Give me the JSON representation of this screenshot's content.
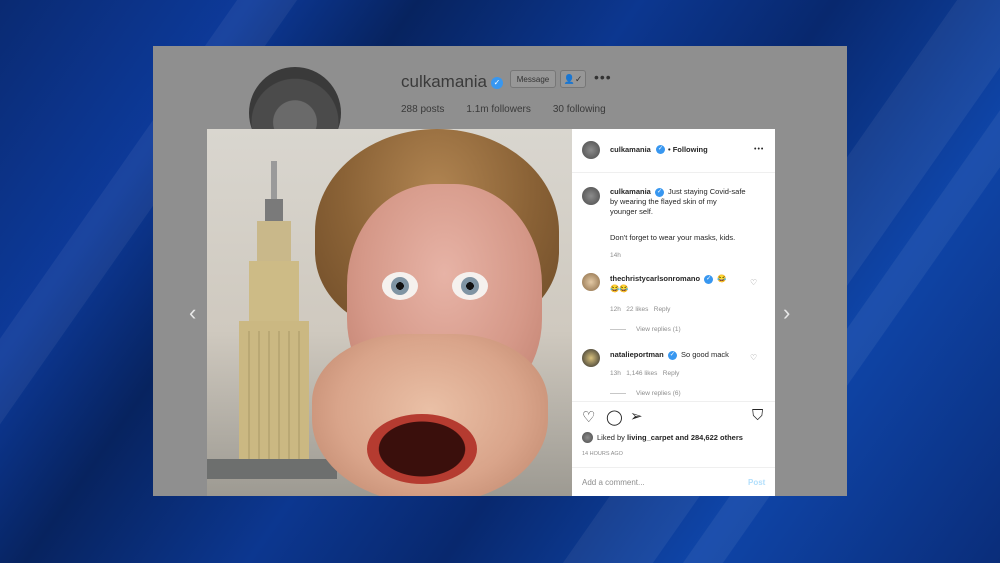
{
  "colors": {
    "verified": "#3897f0",
    "link": "#00376b",
    "post_disabled": "#b2dffc"
  },
  "profile": {
    "username": "culkamania",
    "message_label": "Message",
    "follow_glyph": "👤✓",
    "more_glyph": "•••",
    "posts": "288 posts",
    "followers": "1.1m followers",
    "following": "30 following"
  },
  "nav": {
    "prev_glyph": "‹",
    "next_glyph": "›"
  },
  "post": {
    "author": "culkamania",
    "follow_state": "• Following",
    "more_glyph": "•••",
    "caption_line1": "Just staying Covid-safe",
    "caption_line2": "by wearing the flayed skin of my",
    "caption_line3": "younger self.",
    "caption_line4": "Don't forget to wear your masks, kids.",
    "caption_time": "14h",
    "comments": [
      {
        "user": "thechristycarlsonromano",
        "text": "😂",
        "text2": "😂😂",
        "time": "12h",
        "likes": "22 likes",
        "reply": "Reply",
        "view_replies": "View replies (1)"
      },
      {
        "user": "natalieportman",
        "text": "So good mack",
        "time": "13h",
        "likes": "1,146 likes",
        "reply": "Reply",
        "view_replies": "View replies (6)"
      }
    ],
    "liked_prefix": "Liked by",
    "liked_user": "living_carpet",
    "liked_suffix": "and 284,622 others",
    "timestamp": "14 HOURS AGO",
    "comment_placeholder": "Add a comment...",
    "post_button": "Post"
  }
}
